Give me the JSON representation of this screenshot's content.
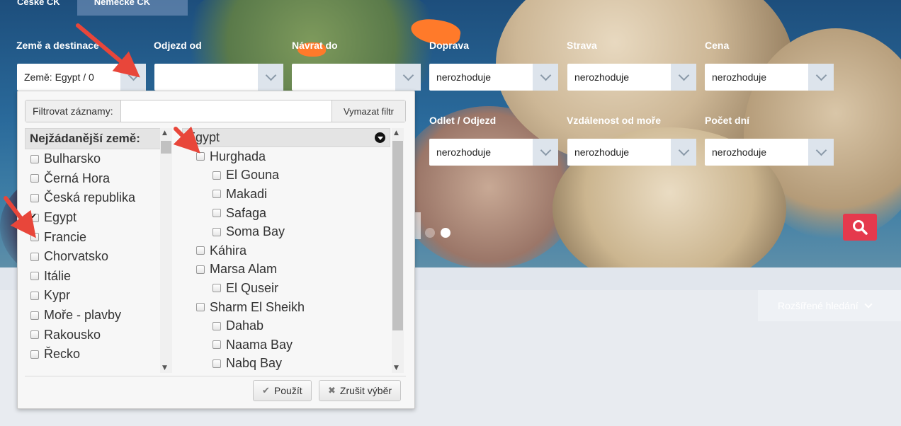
{
  "tabs": [
    {
      "label": "České CK"
    },
    {
      "label": "Německé CK"
    }
  ],
  "filters": {
    "destination": {
      "label": "Země a destinace",
      "value": "Země: Egypt / 0"
    },
    "departure": {
      "label": "Odjezd od",
      "value": ""
    },
    "return": {
      "label": "Návrat do",
      "value": ""
    },
    "transport": {
      "label": "Doprava",
      "value": "nerozhoduje"
    },
    "board": {
      "label": "Strava",
      "value": "nerozhoduje"
    },
    "price": {
      "label": "Cena",
      "value": "nerozhoduje"
    },
    "airport": {
      "label": "Odlet / Odjezd",
      "value": "nerozhoduje"
    },
    "sea_distance": {
      "label": "Vzdálenost od moře",
      "value": "nerozhoduje"
    },
    "days": {
      "label": "Počet dní",
      "value": "nerozhoduje"
    }
  },
  "advanced_search": {
    "label": "Rozšířené hledání"
  },
  "dropdown": {
    "filter_label": "Filtrovat záznamy:",
    "filter_value": "",
    "clear_filter": "Vymazat filtr",
    "countries_header": "Nejžádanější země:",
    "countries": [
      {
        "label": "Bulharsko",
        "checked": false
      },
      {
        "label": "Černá Hora",
        "checked": false
      },
      {
        "label": "Česká republika",
        "checked": false
      },
      {
        "label": "Egypt",
        "checked": true
      },
      {
        "label": "Francie",
        "checked": false
      },
      {
        "label": "Chorvatsko",
        "checked": false
      },
      {
        "label": "Itálie",
        "checked": false
      },
      {
        "label": "Kypr",
        "checked": false
      },
      {
        "label": "Moře - plavby",
        "checked": false
      },
      {
        "label": "Rakousko",
        "checked": false
      },
      {
        "label": "Řecko",
        "checked": false
      }
    ],
    "region_header": "Egypt",
    "regions": [
      {
        "label": "Hurghada",
        "level": 1
      },
      {
        "label": "El Gouna",
        "level": 2
      },
      {
        "label": "Makadi",
        "level": 2
      },
      {
        "label": "Safaga",
        "level": 2
      },
      {
        "label": "Soma Bay",
        "level": 2
      },
      {
        "label": "Káhira",
        "level": 1
      },
      {
        "label": "Marsa Alam",
        "level": 1
      },
      {
        "label": "El Quseir",
        "level": 2
      },
      {
        "label": "Sharm El Sheikh",
        "level": 1
      },
      {
        "label": "Dahab",
        "level": 2
      },
      {
        "label": "Naama Bay",
        "level": 2
      },
      {
        "label": "Nabq Bay",
        "level": 2
      }
    ],
    "apply": "Použít",
    "cancel": "Zrušit výběr"
  },
  "colors": {
    "accent": "#e5394d",
    "annotation_arrow": "#e8463a"
  }
}
